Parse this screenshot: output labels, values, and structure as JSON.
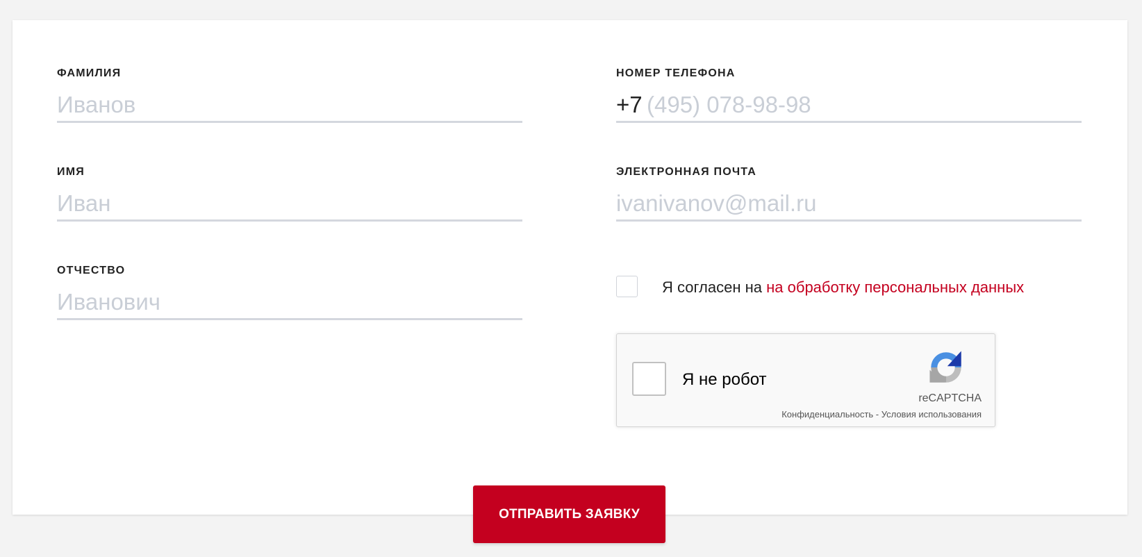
{
  "form": {
    "left_column": [
      {
        "label": "ФАМИЛИЯ",
        "placeholder": "Иванов",
        "value": ""
      },
      {
        "label": "ИМЯ",
        "placeholder": "Иван",
        "value": ""
      },
      {
        "label": "ОТЧЕСТВО",
        "placeholder": "Иванович",
        "value": ""
      }
    ],
    "phone": {
      "label": "НОМЕР ТЕЛЕФОНА",
      "prefix": "+7",
      "placeholder": "(495) 078-98-98",
      "value": ""
    },
    "email": {
      "label": "ЭЛЕКТРОННАЯ ПОЧТА",
      "placeholder": "ivanivanov@mail.ru",
      "value": ""
    },
    "consent": {
      "checked": false,
      "text": "Я согласен на",
      "link_text": "на обработку персональных данных"
    },
    "recaptcha": {
      "label": "Я не робот",
      "brand": "reCAPTCHA",
      "privacy": "Конфиденциальность",
      "separator": "-",
      "terms": "Условия использования",
      "checked": false
    },
    "submit_label": "ОТПРАВИТЬ ЗАЯВКУ"
  },
  "colors": {
    "accent": "#c4001f",
    "page_background": "#f3f3f3",
    "card_background": "#ffffff",
    "placeholder": "#c9ced6",
    "underline": "#d4d7de"
  }
}
